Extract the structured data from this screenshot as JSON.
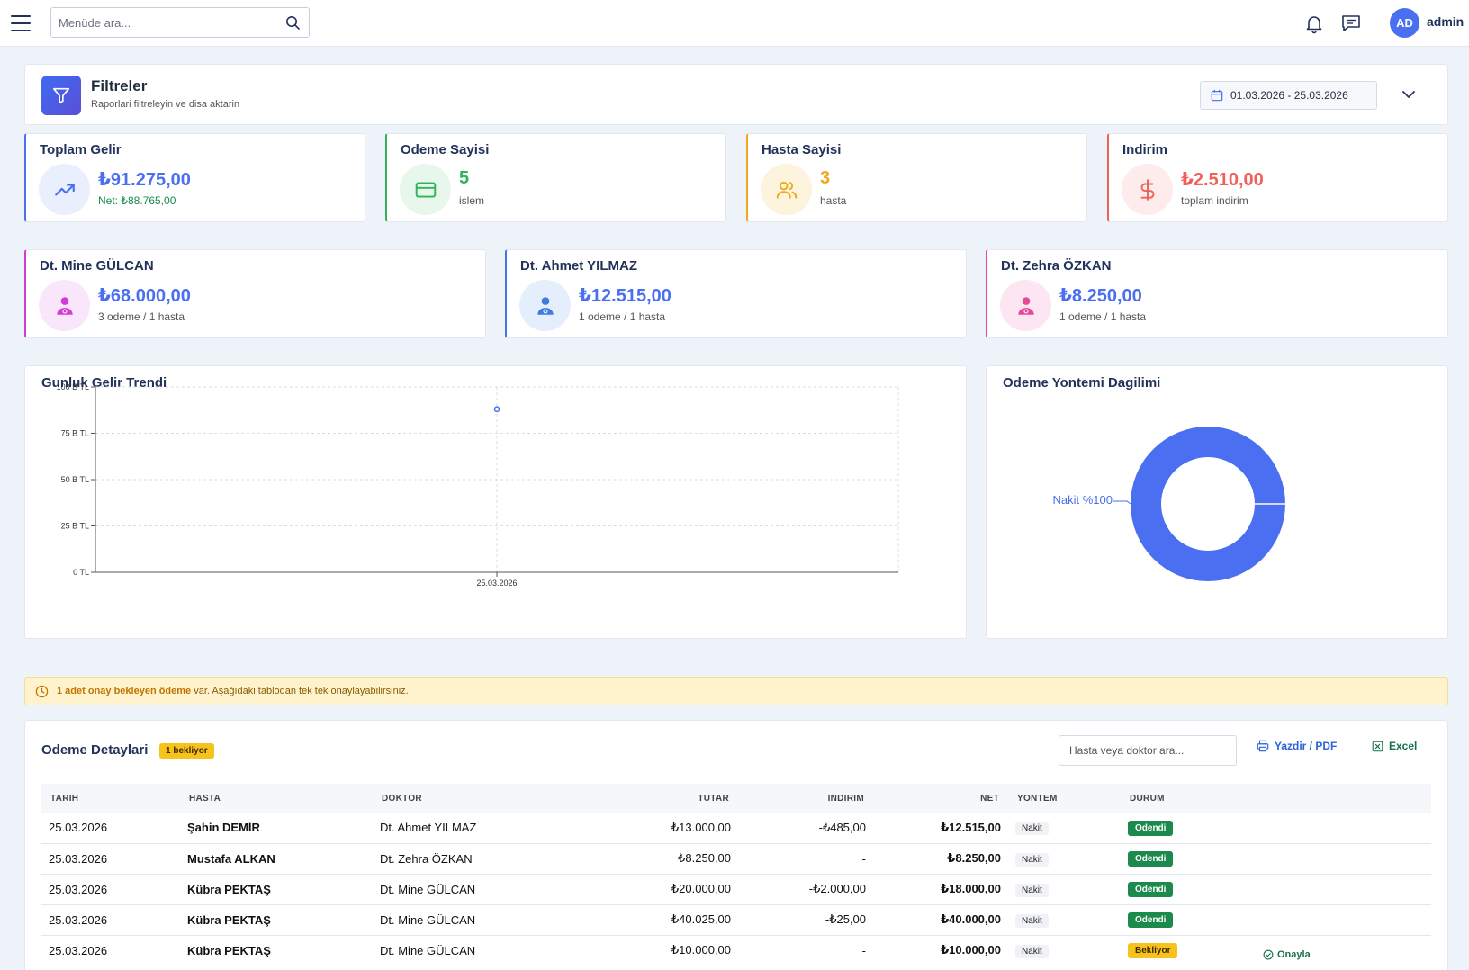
{
  "topbar": {
    "search_placeholder": "Menüde ara...",
    "avatar_initials": "AD",
    "username": "admin"
  },
  "filters": {
    "title": "Filtreler",
    "subtitle": "Raporlari filtreleyin ve disa aktarin",
    "date_range": "01.03.2026 - 25.03.2026"
  },
  "stats": [
    {
      "label": "Toplam Gelir",
      "value": "₺91.275,00",
      "sub": "Net: ₺88.765,00",
      "color": "#4a6ff0",
      "icon": "trend-up-icon"
    },
    {
      "label": "Odeme Sayisi",
      "value": "5",
      "sub": "islem",
      "color": "#2fb45a",
      "icon": "credit-card-icon"
    },
    {
      "label": "Hasta Sayisi",
      "value": "3",
      "sub": "hasta",
      "color": "#f0a91c",
      "icon": "users-icon"
    },
    {
      "label": "Indirim",
      "value": "₺2.510,00",
      "sub": "toplam indirim",
      "color": "#f0605a",
      "icon": "dollar-icon"
    }
  ],
  "doctors": [
    {
      "name": "Dt. Mine GÜLCAN",
      "value": "₺68.000,00",
      "sub": "3 odeme / 1 hasta",
      "color": "#d63ad6"
    },
    {
      "name": "Dt. Ahmet YILMAZ",
      "value": "₺12.515,00",
      "sub": "1 odeme / 1 hasta",
      "color": "#3f7ae0"
    },
    {
      "name": "Dt. Zehra ÖZKAN",
      "value": "₺8.250,00",
      "sub": "1 odeme / 1 hasta",
      "color": "#e8469b"
    }
  ],
  "trend_chart": {
    "title": "Gunluk Gelir Trendi"
  },
  "pie_chart": {
    "title": "Odeme Yontemi Dagilimi",
    "slice_label": "Nakit %100"
  },
  "chart_data": [
    {
      "type": "line",
      "title": "Gunluk Gelir Trendi",
      "x": [
        "25.03.2026"
      ],
      "y": [
        88
      ],
      "y_unit": "B TL",
      "yticks": [
        "0 TL",
        "25 B TL",
        "50 B TL",
        "75 B TL",
        "100 B TL"
      ],
      "ylim": [
        0,
        100
      ],
      "grid": true
    },
    {
      "type": "pie",
      "title": "Odeme Yontemi Dagilimi",
      "labels": [
        "Nakit %100"
      ],
      "values": [
        100
      ],
      "donut": true
    }
  ],
  "alert": {
    "bold": "1 adet onay bekleyen ödeme",
    "text": " var. Aşağıdaki tablodan tek tek onaylayabilirsiniz."
  },
  "payments": {
    "title": "Odeme Detaylari",
    "badge": "1 bekliyor",
    "search_placeholder": "Hasta veya doktor ara...",
    "print_label": "Yazdir / PDF",
    "excel_label": "Excel",
    "columns": [
      "TARIH",
      "HASTA",
      "DOKTOR",
      "TUTAR",
      "INDIRIM",
      "NET",
      "YONTEM",
      "DURUM"
    ],
    "rows": [
      {
        "date": "25.03.2026",
        "patient": "Şahin DEMİR",
        "doctor": "Dt. Ahmet YILMAZ",
        "amount": "₺13.000,00",
        "discount": "-₺485,00",
        "net": "₺12.515,00",
        "method": "Nakit",
        "status": "Odendi"
      },
      {
        "date": "25.03.2026",
        "patient": "Mustafa ALKAN",
        "doctor": "Dt. Zehra ÖZKAN",
        "amount": "₺8.250,00",
        "discount": "-",
        "net": "₺8.250,00",
        "method": "Nakit",
        "status": "Odendi"
      },
      {
        "date": "25.03.2026",
        "patient": "Kübra PEKTAŞ",
        "doctor": "Dt. Mine GÜLCAN",
        "amount": "₺20.000,00",
        "discount": "-₺2.000,00",
        "net": "₺18.000,00",
        "method": "Nakit",
        "status": "Odendi"
      },
      {
        "date": "25.03.2026",
        "patient": "Kübra PEKTAŞ",
        "doctor": "Dt. Mine GÜLCAN",
        "amount": "₺40.025,00",
        "discount": "-₺25,00",
        "net": "₺40.000,00",
        "method": "Nakit",
        "status": "Odendi"
      },
      {
        "date": "25.03.2026",
        "patient": "Kübra PEKTAŞ",
        "doctor": "Dt. Mine GÜLCAN",
        "amount": "₺10.000,00",
        "discount": "-",
        "net": "₺10.000,00",
        "method": "Nakit",
        "status": "Bekliyor",
        "action": "Onayla"
      }
    ]
  }
}
